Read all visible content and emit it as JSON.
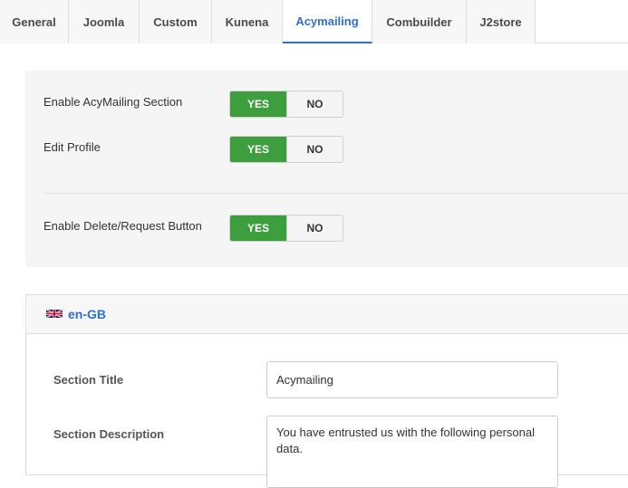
{
  "tabs": [
    {
      "label": "General",
      "active": false
    },
    {
      "label": "Joomla",
      "active": false
    },
    {
      "label": "Custom",
      "active": false
    },
    {
      "label": "Kunena",
      "active": false
    },
    {
      "label": "Acymailing",
      "active": true
    },
    {
      "label": "Combuilder",
      "active": false
    },
    {
      "label": "J2store",
      "active": false
    }
  ],
  "settings": {
    "rows": [
      {
        "label": "Enable AcyMailing Section",
        "yes": "YES",
        "no": "NO",
        "value": "YES"
      },
      {
        "label": "Edit Profile",
        "yes": "YES",
        "no": "NO",
        "value": "YES"
      },
      {
        "label": "Enable Delete/Request Button",
        "yes": "YES",
        "no": "NO",
        "value": "YES"
      }
    ]
  },
  "language": {
    "code": "en-GB",
    "flag_icon": "uk-flag-icon",
    "section_title_label": "Section Title",
    "section_title_value": "Acymailing",
    "section_description_label": "Section Description",
    "section_description_value": "You have entrusted us with the following personal data."
  },
  "colors": {
    "accent": "#2f6fd1",
    "yes_active": "#3d9e3d"
  }
}
